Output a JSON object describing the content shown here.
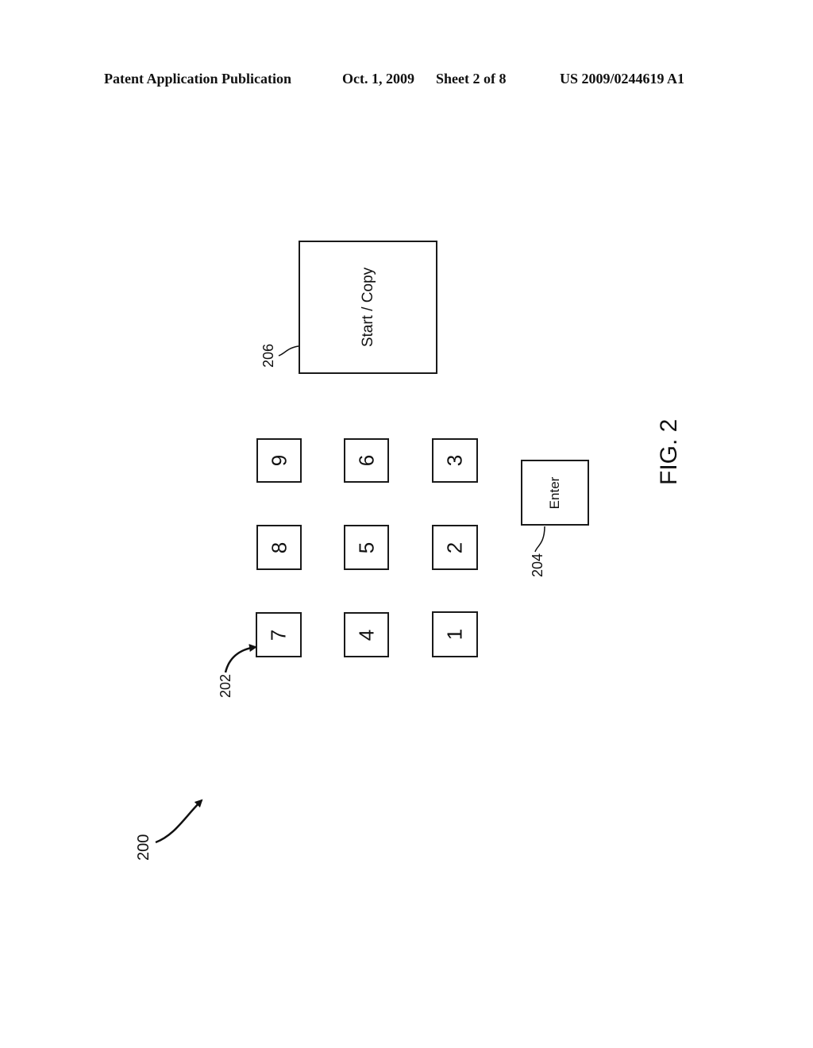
{
  "header": {
    "publication": "Patent Application Publication",
    "date": "Oct. 1, 2009",
    "sheet": "Sheet 2 of 8",
    "number": "US 2009/0244619 A1"
  },
  "figure": {
    "label": "FIG. 2",
    "reference": "200",
    "start_copy": {
      "label": "Start / Copy",
      "ref": "206"
    },
    "enter": {
      "label": "Enter",
      "ref": "204"
    },
    "keypad": {
      "ref": "202",
      "keys": [
        "1",
        "2",
        "3",
        "4",
        "5",
        "6",
        "7",
        "8",
        "9"
      ]
    }
  }
}
